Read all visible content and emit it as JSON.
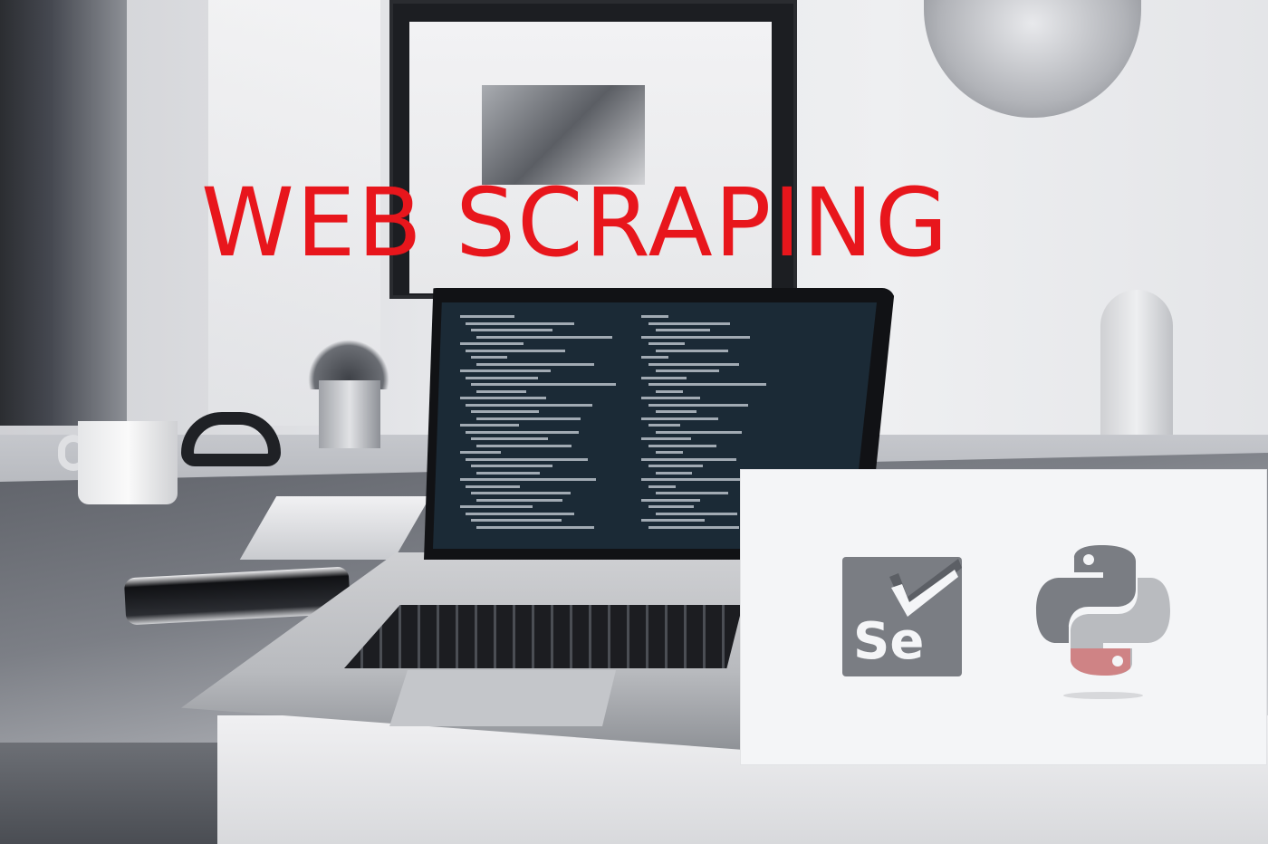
{
  "headline": {
    "text": "WEB SCRAPING",
    "color": "#e8161c"
  },
  "logos": {
    "selenium": {
      "icon": "selenium-logo-icon",
      "label": "Se",
      "color": "#7a7d83"
    },
    "python": {
      "icon": "python-logo-icon",
      "color": "#7a7d83"
    }
  },
  "background": {
    "description_icon": "desk-workspace-photo"
  }
}
